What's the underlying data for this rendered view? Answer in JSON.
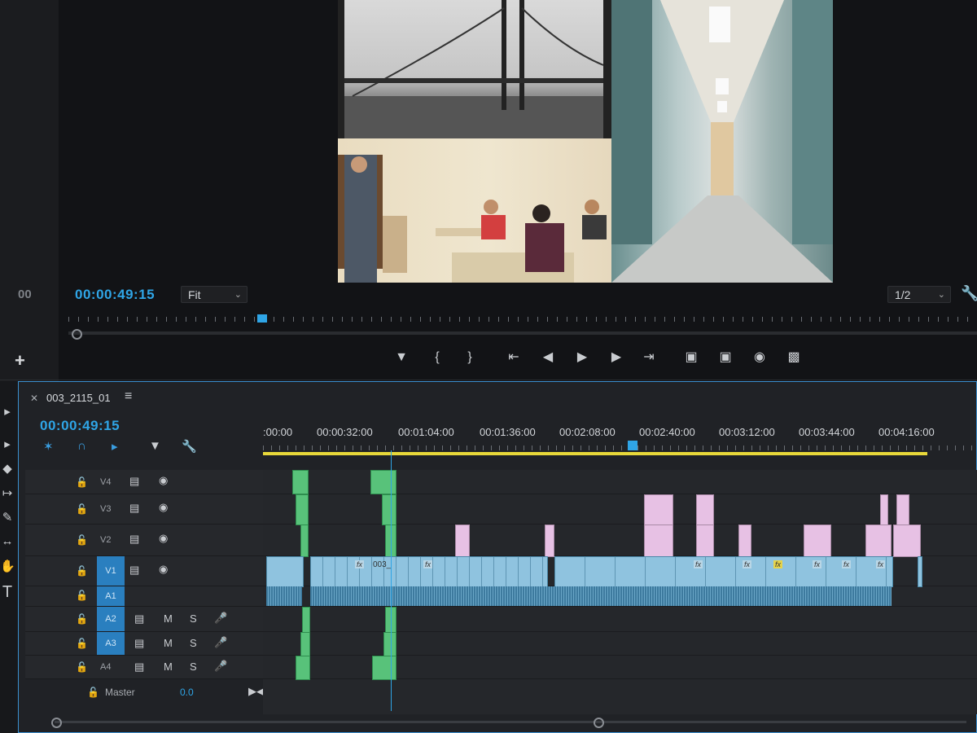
{
  "monitor": {
    "timecode_left": "00",
    "timecode": "00:00:49:15",
    "zoom": "Fit",
    "resolution": "1/2",
    "add_button": "+",
    "transport": [
      "add-marker",
      "mark-in",
      "mark-out",
      "go-to-in",
      "step-back",
      "play",
      "step-forward",
      "go-to-out",
      "lift",
      "extract",
      "export-frame",
      "compare"
    ]
  },
  "timeline": {
    "sequence_name": "003_2115_01",
    "timecode": "00:00:49:15",
    "ruler_labels": [
      ":00:00",
      "00:00:32:00",
      "00:01:04:00",
      "00:01:36:00",
      "00:02:08:00",
      "00:02:40:00",
      "00:03:12:00",
      "00:03:44:00",
      "00:04:16:00"
    ],
    "tracks": {
      "v4": "V4",
      "v3": "V3",
      "v2": "V2",
      "v1": "V1",
      "a1": "A1",
      "a2": "A2",
      "a3": "A3",
      "a4": "A4"
    },
    "mute": "M",
    "solo": "S",
    "master_label": "Master",
    "master_value": "0.0",
    "clip_name": "003_",
    "fx_label": "fx"
  },
  "colors": {
    "accent_blue": "#2fa5e6",
    "work_area": "#e8d83a",
    "green_clip": "#58c27a",
    "pink_clip": "#e7c1e4",
    "video_clip": "#8fc3df"
  }
}
